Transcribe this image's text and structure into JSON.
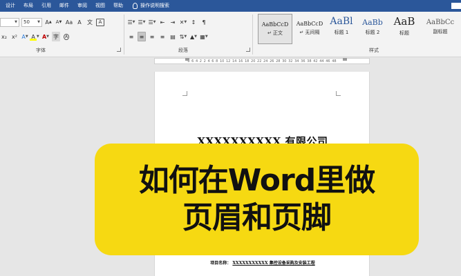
{
  "menu": {
    "tabs": [
      "设计",
      "布局",
      "引用",
      "邮件",
      "审阅",
      "视图",
      "帮助"
    ],
    "tell_me": "操作说明搜索"
  },
  "ribbon": {
    "font": {
      "name_value": "",
      "size_value": "50",
      "grow_label": "A",
      "shrink_label": "A",
      "case_label": "Aa",
      "clear_label": "A",
      "wen_label": "文",
      "border_label": "A",
      "row2": [
        "x₂",
        "x²",
        "A",
        "A",
        "A",
        "字",
        "A"
      ],
      "group_label": "字体"
    },
    "paragraph": {
      "group_label": "段落",
      "row1": [
        "☰",
        "☰",
        "☰",
        "⇤",
        "⇥",
        "✕",
        "↕",
        "¶"
      ],
      "row2": [
        "≡",
        "≡",
        "≡",
        "≡",
        "▤",
        "⇅",
        "▲",
        "▦"
      ]
    },
    "styles": {
      "group_label": "样式",
      "items": [
        {
          "sample": "AaBbCcD",
          "name": "↵ 正文"
        },
        {
          "sample": "AaBbCcD",
          "name": "↵ 无间隔"
        },
        {
          "sample": "AaBl",
          "name": "标题 1"
        },
        {
          "sample": "AaBb",
          "name": "标题 2"
        },
        {
          "sample": "AaB",
          "name": "标题"
        },
        {
          "sample": "AaBbCc",
          "name": "副标题"
        }
      ]
    }
  },
  "ruler": {
    "ticks": [
      "8",
      "6",
      "4",
      "2",
      "2",
      "4",
      "6",
      "8",
      "10",
      "12",
      "14",
      "16",
      "18",
      "20",
      "22",
      "24",
      "26",
      "28",
      "30",
      "32",
      "34",
      "36",
      "38",
      "42",
      "44",
      "46",
      "48"
    ]
  },
  "document": {
    "company_title": "XXXXXXXXXX 有限公司",
    "project_label": "项目名称：",
    "project_value": "XXXXXXXXXXX 集控设备采购及安装工程"
  },
  "overlay": {
    "line1": "如何在Word里做",
    "line2": "页眉和页脚",
    "color": "#f6d912"
  },
  "colors": {
    "title_bar": "#2b579a",
    "font_color_red": "#c00000",
    "highlight_yellow": "#ffff00"
  }
}
